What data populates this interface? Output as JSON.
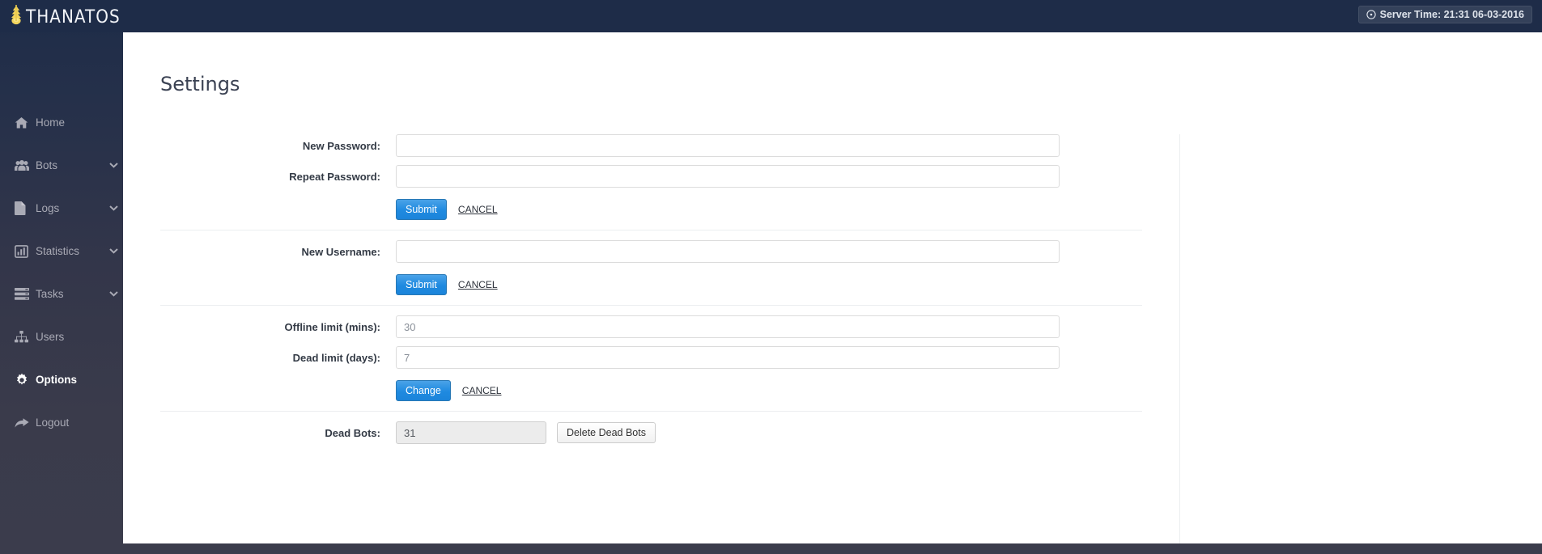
{
  "header": {
    "brand": "THANATOS",
    "brand_icon": "thanatos-logo-icon",
    "server_time_icon": "clock-icon",
    "server_time": "Server Time: 21:31 06-03-2016",
    "background": "#1e2c48"
  },
  "sidebar": {
    "items": [
      {
        "label": "Home",
        "icon": "home-icon",
        "caret": false,
        "active": false,
        "arrow": true
      },
      {
        "label": "Bots",
        "icon": "users-group-icon",
        "caret": true,
        "active": false,
        "arrow": false
      },
      {
        "label": "Logs",
        "icon": "file-icon",
        "caret": true,
        "active": false,
        "arrow": false
      },
      {
        "label": "Statistics",
        "icon": "bar-chart-icon",
        "caret": true,
        "active": false,
        "arrow": false
      },
      {
        "label": "Tasks",
        "icon": "server-icon",
        "caret": true,
        "active": false,
        "arrow": false
      },
      {
        "label": "Users",
        "icon": "sitemap-icon",
        "caret": false,
        "active": false,
        "arrow": false
      },
      {
        "label": "Options",
        "icon": "gear-icon",
        "caret": false,
        "active": true,
        "arrow": false
      },
      {
        "label": "Logout",
        "icon": "share-arrow-icon",
        "caret": false,
        "active": false,
        "arrow": false
      }
    ]
  },
  "main": {
    "title": "Settings",
    "password_section": {
      "new_password_label": "New Password:",
      "new_password_value": "",
      "repeat_password_label": "Repeat Password:",
      "repeat_password_value": "",
      "submit_label": "Submit",
      "cancel_label": "CANCEL"
    },
    "username_section": {
      "new_username_label": "New Username:",
      "new_username_value": "",
      "submit_label": "Submit",
      "cancel_label": "CANCEL"
    },
    "limits_section": {
      "offline_limit_label": "Offline limit (mins):",
      "offline_limit_value": "30",
      "dead_limit_label": "Dead limit (days):",
      "dead_limit_value": "7",
      "change_label": "Change",
      "cancel_label": "CANCEL"
    },
    "dead_bots_section": {
      "dead_bots_label": "Dead Bots:",
      "dead_bots_value": "31",
      "delete_label": "Delete Dead Bots"
    }
  },
  "colors": {
    "accent_blue": "#1f8ae0",
    "sidebar_top": "#1e2c48",
    "sidebar_bottom": "#3a3b4b",
    "logo_gold": "#f2d45c"
  }
}
